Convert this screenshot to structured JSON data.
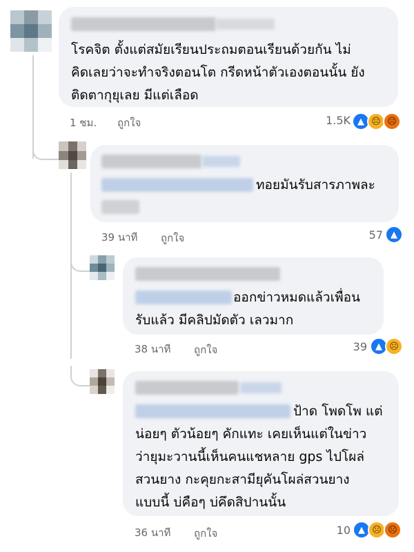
{
  "comments": [
    {
      "id": "c1",
      "text_lines": [
        "โรคจิต ตั้งแต่สมัยเรียนประถมตอนเรียนด้วยกัน ไม่",
        "คิดเลยว่าจะทำจริงตอนโต กรีดหน้าตัวเองตอนนั้น ยัง",
        "ติดตากุยุเลย มีแต่เลือด"
      ],
      "time": "1 ชม.",
      "like_label": "ถูกใจ",
      "reaction_count": "1.5K",
      "reactions": [
        "like-icon",
        "sad-icon",
        "angry-icon"
      ]
    },
    {
      "id": "c2",
      "text_lines": [
        "ทอยมันรับสารภาพละ"
      ],
      "time": "39 นาที",
      "like_label": "ถูกใจ",
      "reaction_count": "57",
      "reactions": [
        "like-icon"
      ]
    },
    {
      "id": "c3",
      "text_lines": [
        "ออกข่าวหมดแล้วเพื่อน",
        "รับแล้ว มีคลิปมัดตัว เลวมาก"
      ],
      "time": "38 นาที",
      "like_label": "ถูกใจ",
      "reaction_count": "39",
      "reactions": [
        "like-icon",
        "sad-icon"
      ]
    },
    {
      "id": "c4",
      "text_lines": [
        "ป้าด โพดโพ แต่",
        "น่อยๆ ตัวน้อยๆ คักแทะ เคยเห็นแต่ในข่าว",
        "ว่ายุมะวานนี้เห็นคนแชหลาย gps ไปโผล่",
        "สวนยาง กะคุยกะสามียุคันโผล่สวนยาง",
        "แบบนี้ บ่คือๆ บ่คึดสิปานนั้น"
      ],
      "time": "36 นาที",
      "like_label": "ถูกใจ",
      "reaction_count": "10",
      "reactions": [
        "like-icon",
        "sad-icon",
        "angry-icon"
      ]
    }
  ],
  "colors": {
    "bubble": "#f0f2f5",
    "meta_text": "#65676b",
    "like": "#1877f2",
    "sad": "#f7b125",
    "angry": "#e9710f",
    "thread_line": "#ced0d4"
  }
}
